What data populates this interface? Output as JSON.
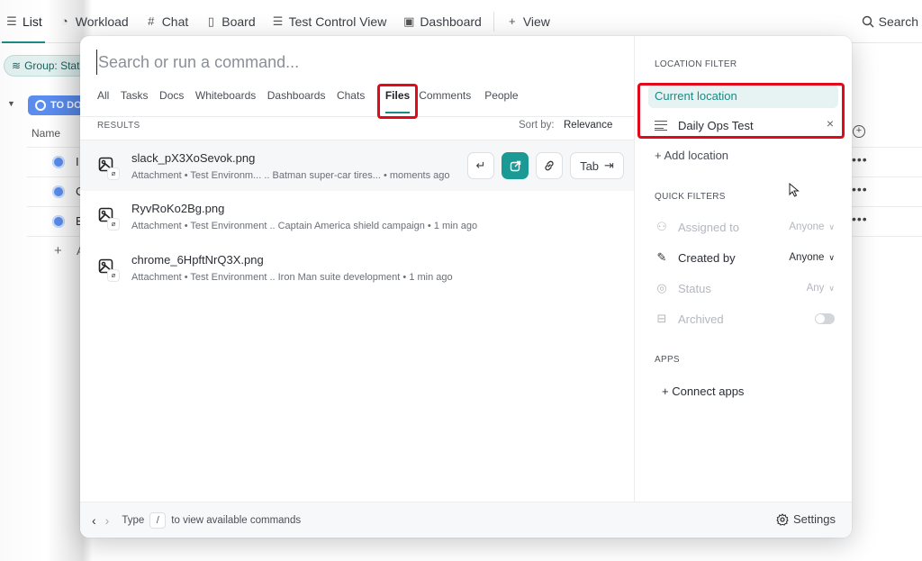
{
  "topbar": {
    "views": [
      {
        "icon": "list-icon",
        "glyph": "☰",
        "label": "List",
        "active": true
      },
      {
        "icon": "workload-icon",
        "glyph": "◔",
        "label": "Workload"
      },
      {
        "icon": "hash-icon",
        "glyph": "#",
        "label": "Chat"
      },
      {
        "icon": "board-icon",
        "glyph": "▯",
        "label": "Board"
      },
      {
        "icon": "list-icon",
        "glyph": "☰",
        "label": "Test Control View"
      },
      {
        "icon": "dashboard-icon",
        "glyph": "▣",
        "label": "Dashboard"
      }
    ],
    "add_view_label": "View",
    "search_label": "Search"
  },
  "background": {
    "group_chip": "Group: Status",
    "status_pill": "TO DO",
    "name_column": "Name",
    "rows": [
      {
        "initial": "I"
      },
      {
        "initial": "C"
      },
      {
        "initial": "B"
      }
    ],
    "add_task_initial": "A",
    "more_glyph": "•••"
  },
  "palette": {
    "search": {
      "placeholder": "Search or run a command...",
      "value": ""
    },
    "tabs": [
      {
        "label": "All"
      },
      {
        "label": "Tasks"
      },
      {
        "label": "Docs"
      },
      {
        "label": "Whiteboards"
      },
      {
        "label": "Dashboards"
      },
      {
        "label": "Chats"
      },
      {
        "label": "Files",
        "active": true
      },
      {
        "label": "Comments"
      },
      {
        "label": "People"
      }
    ],
    "results_label": "RESULTS",
    "sort_by_label": "Sort by:",
    "sort_by_value": "Relevance",
    "results": [
      {
        "name": "slack_pX3XoSevok.png",
        "meta": "Attachment • Test Environm... .. Batman super-car tires... • moments ago",
        "hovered": true
      },
      {
        "name": "RyvRoKo2Bg.png",
        "meta": "Attachment • Test Environment .. Captain America shield campaign • 1 min ago"
      },
      {
        "name": "chrome_6HpftNrQ3X.png",
        "meta": "Attachment • Test Environment .. Iron Man suite development • 1 min ago"
      }
    ],
    "row_actions": {
      "enter_glyph": "↵",
      "open_glyph": "↗",
      "link_glyph": "🔗",
      "tab_label": "Tab",
      "tab_glyph": "⇥"
    },
    "side": {
      "location_filter_label": "LOCATION FILTER",
      "current_location": "Current location",
      "location_item": "Daily Ops Test",
      "add_location": "+ Add location",
      "quick_filters_label": "QUICK FILTERS",
      "quick_filters": [
        {
          "icon": "users-icon",
          "glyph": "👥",
          "label": "Assigned to",
          "value": "Anyone",
          "enabled": false
        },
        {
          "icon": "user-edit-icon",
          "glyph": "✎",
          "label": "Created by",
          "value": "Anyone",
          "enabled": true
        },
        {
          "icon": "status-icon",
          "glyph": "◎",
          "label": "Status",
          "value": "Any",
          "enabled": false
        },
        {
          "icon": "archive-icon",
          "glyph": "▭",
          "label": "Archived",
          "toggle": false,
          "enabled": false
        }
      ],
      "apps_label": "APPS",
      "connect_apps": "+ Connect apps"
    },
    "footer": {
      "type_label": "Type",
      "key": "/",
      "hint": "to view available commands",
      "settings_label": "Settings"
    }
  },
  "colors": {
    "accent": "#1b9a95",
    "highlight_box": "#e00a1a",
    "status_blue": "#5b8def"
  }
}
